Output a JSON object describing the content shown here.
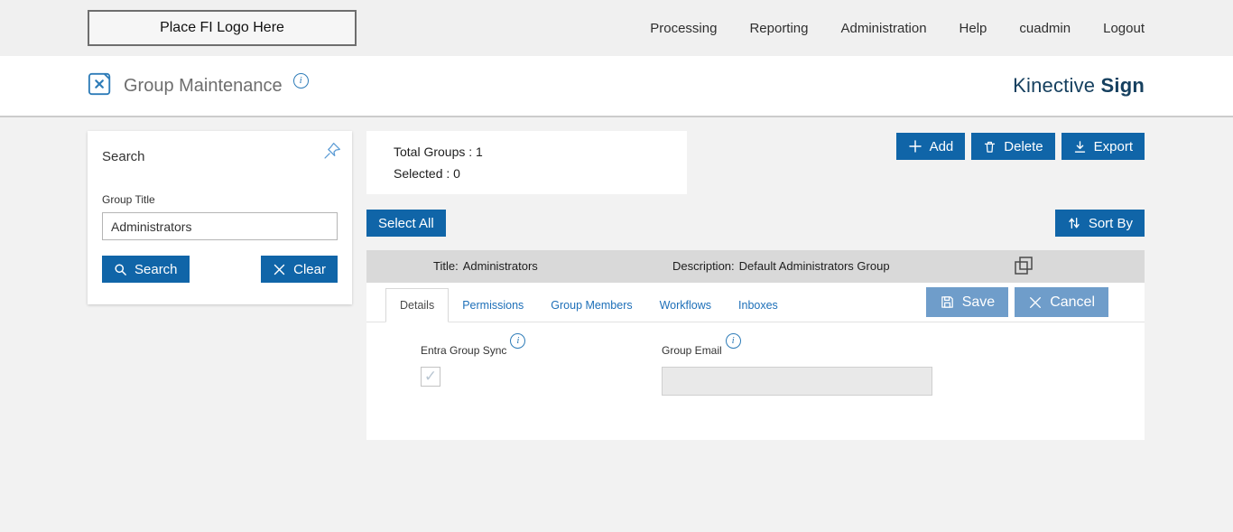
{
  "topnav": {
    "logo_placeholder": "Place FI Logo Here",
    "items": [
      {
        "label": "Processing"
      },
      {
        "label": "Reporting"
      },
      {
        "label": "Administration"
      },
      {
        "label": "Help"
      },
      {
        "label": "cuadmin"
      },
      {
        "label": "Logout"
      }
    ]
  },
  "header": {
    "title": "Group Maintenance",
    "brand_first": "Kinective ",
    "brand_second": "Sign"
  },
  "search_panel": {
    "title": "Search",
    "group_title_label": "Group Title",
    "group_title_value": "Administrators",
    "search_button": "Search",
    "clear_button": "Clear"
  },
  "summary": {
    "total": "Total Groups : 1",
    "selected": "Selected : 0"
  },
  "toolbar": {
    "add": "Add",
    "delete": "Delete",
    "export": "Export",
    "select_all": "Select All",
    "sort_by": "Sort By"
  },
  "group_row": {
    "title_label": "Title:",
    "title_value": "Administrators",
    "description_label": "Description:",
    "description_value": "Default Administrators Group"
  },
  "tabs": [
    {
      "label": "Details"
    },
    {
      "label": "Permissions"
    },
    {
      "label": "Group Members"
    },
    {
      "label": "Workflows"
    },
    {
      "label": "Inboxes"
    }
  ],
  "actions": {
    "save": "Save",
    "cancel": "Cancel"
  },
  "details": {
    "entra_label": "Entra Group Sync",
    "entra_checked": true,
    "check_glyph": "✓",
    "email_label": "Group Email",
    "email_value": ""
  },
  "colors": {
    "accent": "#1065a8",
    "muted_action": "#6f9dca",
    "brand": "#16405f",
    "row_gray": "#d9d9d9"
  }
}
